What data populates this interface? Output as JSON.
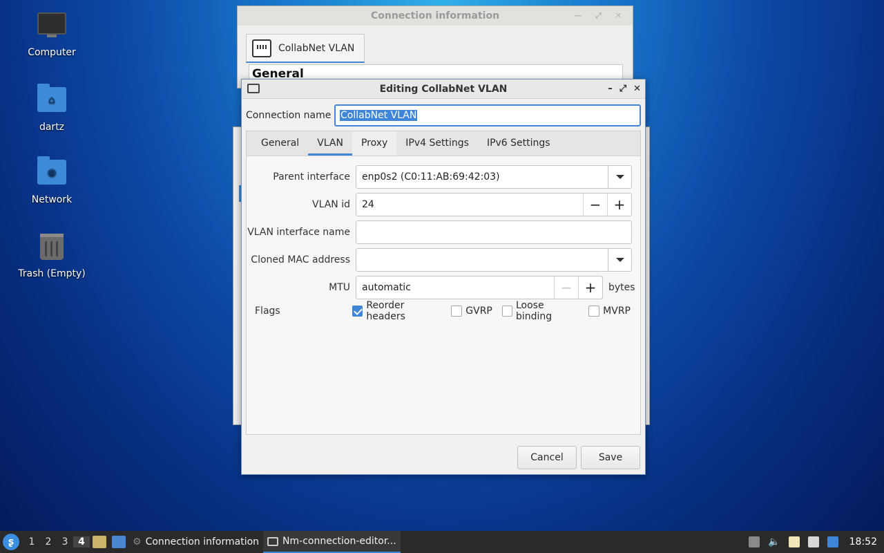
{
  "desktop": {
    "icons": [
      {
        "label": "Computer",
        "icon": "computer-icon"
      },
      {
        "label": "dartz",
        "icon": "home-folder-icon"
      },
      {
        "label": "Network",
        "icon": "network-folder-icon"
      },
      {
        "label": "Trash (Empty)",
        "icon": "trash-icon"
      }
    ]
  },
  "bg_window": {
    "title": "Connection information",
    "tab_label": "CollabNet VLAN",
    "section": "General"
  },
  "dialog": {
    "title": "Editing CollabNet VLAN",
    "connection_name_label": "Connection name",
    "connection_name_value": "CollabNet VLAN",
    "tabs": [
      "General",
      "VLAN",
      "Proxy",
      "IPv4 Settings",
      "IPv6 Settings"
    ],
    "active_tab": "VLAN",
    "fields": {
      "parent_interface_label": "Parent interface",
      "parent_interface_value": "enp0s2 (C0:11:AB:69:42:03)",
      "vlan_id_label": "VLAN id",
      "vlan_id_value": "24",
      "vlan_interface_name_label": "VLAN interface name",
      "vlan_interface_name_value": "",
      "cloned_mac_label": "Cloned MAC address",
      "cloned_mac_value": "",
      "mtu_label": "MTU",
      "mtu_value": "automatic",
      "mtu_suffix": "bytes",
      "flags_label": "Flags"
    },
    "flags": [
      {
        "label": "Reorder headers",
        "checked": true
      },
      {
        "label": "GVRP",
        "checked": false
      },
      {
        "label": "Loose binding",
        "checked": false
      },
      {
        "label": "MVRP",
        "checked": false
      }
    ],
    "buttons": {
      "cancel": "Cancel",
      "save": "Save"
    }
  },
  "taskbar": {
    "workspaces": [
      "1",
      "2",
      "3",
      "4"
    ],
    "active_workspace": "4",
    "tasks": [
      "Connection information",
      "Nm-connection-editor..."
    ],
    "clock": "18:52"
  },
  "colors": {
    "accent": "#3f86d8",
    "taskbar": "#2a2a2a"
  }
}
